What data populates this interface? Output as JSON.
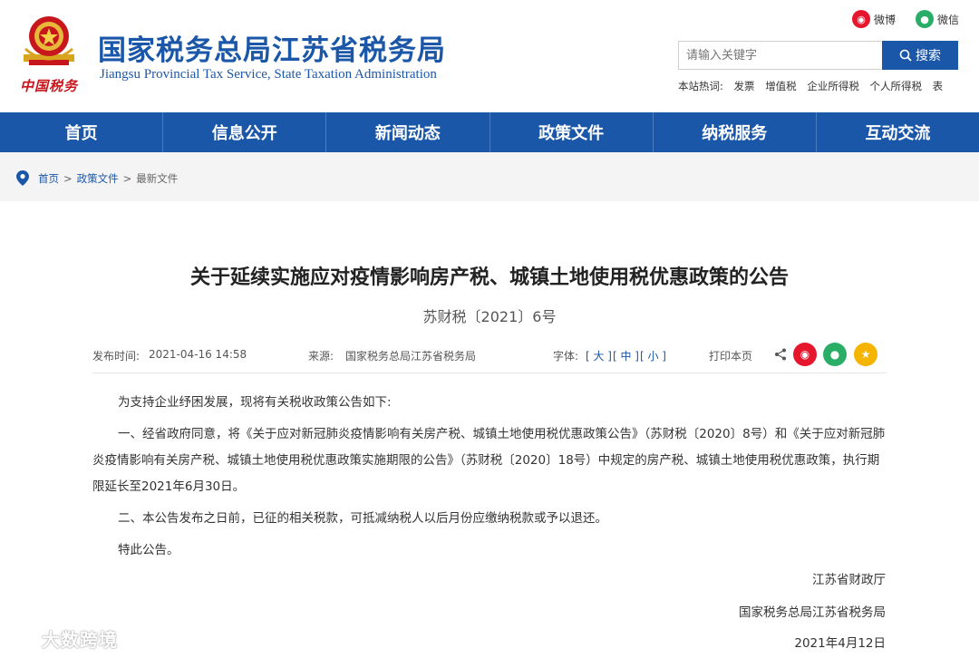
{
  "header": {
    "brand_small": "中国税务",
    "title": "国家税务总局江苏省税务局",
    "subtitle": "Jiangsu Provincial Tax Service, State Taxation Administration",
    "social": [
      {
        "label": "微博",
        "icon": "weibo-icon",
        "color": "#e6162d"
      },
      {
        "label": "微信",
        "icon": "wechat-icon",
        "color": "#2aae67"
      }
    ],
    "search": {
      "placeholder": "请输入关键字",
      "button": "搜索"
    },
    "hotwords": {
      "label": "本站热词:",
      "items": [
        "发票",
        "增值税",
        "企业所得税",
        "个人所得税",
        "表"
      ]
    }
  },
  "nav": [
    "首页",
    "信息公开",
    "新闻动态",
    "政策文件",
    "纳税服务",
    "互动交流"
  ],
  "breadcrumb": {
    "items": [
      "首页",
      "政策文件"
    ],
    "current": "最新文件",
    "separator": ">"
  },
  "article": {
    "title": "关于延续实施应对疫情影响房产税、城镇土地使用税优惠政策的公告",
    "doc_no": "苏财税〔2021〕6号",
    "meta": {
      "publish_label": "发布时间:",
      "publish_time": "2021-04-16 14:58",
      "source_label": "来源:",
      "source": "国家税务总局江苏省税务局",
      "font_label": "字体:",
      "font_large": "[ 大 ]",
      "font_medium": "[ 中 ]",
      "font_small": "[ 小 ]",
      "print": "打印本页"
    },
    "paragraphs": [
      "为支持企业纾困发展，现将有关税收政策公告如下:",
      "一、经省政府同意，将《关于应对新冠肺炎疫情影响有关房产税、城镇土地使用税优惠政策公告》（苏财税〔2020〕8号）和《关于应对新冠肺炎疫情影响有关房产税、城镇土地使用税优惠政策实施期限的公告》（苏财税〔2020〕18号）中规定的房产税、城镇土地使用税优惠政策，执行期限延长至2021年6月30日。",
      "二、本公告发布之日前，已征的相关税款，可抵减纳税人以后月份应缴纳税款或予以退还。",
      "特此公告。"
    ],
    "signature": [
      "江苏省财政厅",
      "国家税务总局江苏省税务局",
      "2021年4月12日"
    ]
  },
  "watermark": "大数跨境",
  "colors": {
    "primary": "#1b57a9",
    "red": "#c8161d",
    "weibo": "#e6162d",
    "wechat": "#2aae67",
    "qzone": "#f4b400"
  }
}
